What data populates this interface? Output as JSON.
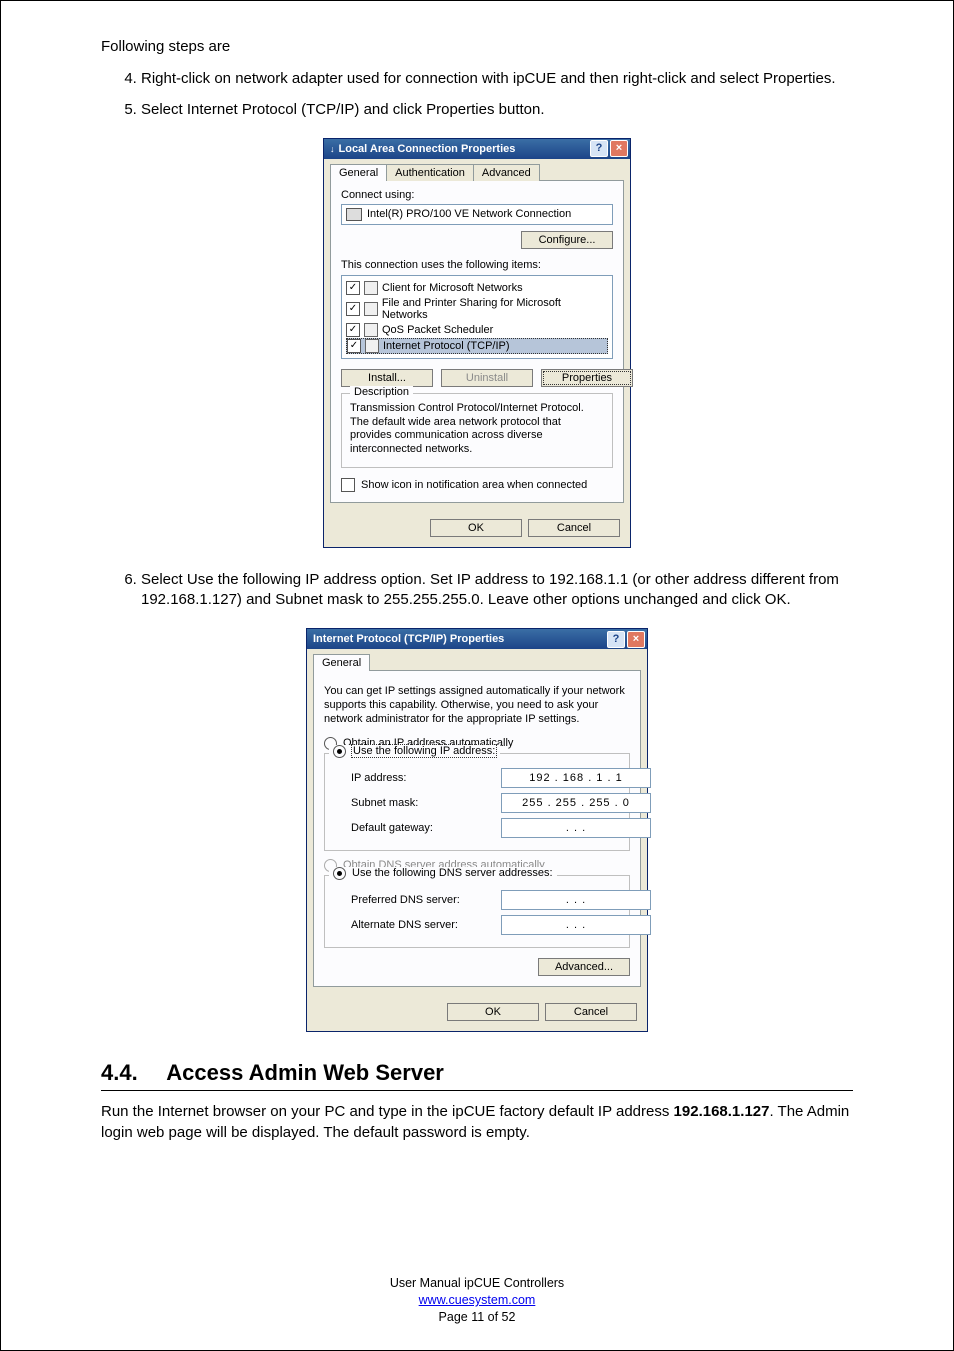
{
  "intro": "Following steps are",
  "steps": {
    "s4": "Right-click on network adapter used for connection with ipCUE and then right-click and select Properties.",
    "s5": "Select Internet Protocol (TCP/IP) and click Properties button.",
    "s6": "Select Use the following IP address option. Set IP address to 192.168.1.1 (or other address different from 192.168.1.127) and Subnet mask to 255.255.255.0. Leave other options unchanged and click OK."
  },
  "lan": {
    "title": "Local Area Connection Properties",
    "tabs": {
      "general": "General",
      "auth": "Authentication",
      "adv": "Advanced"
    },
    "connect_using": "Connect using:",
    "nic": "Intel(R) PRO/100 VE Network Connection",
    "configure": "Configure...",
    "uses_items": "This connection uses the following items:",
    "items": {
      "client": "Client for Microsoft Networks",
      "fps": "File and Printer Sharing for Microsoft Networks",
      "qos": "QoS Packet Scheduler",
      "tcpip": "Internet Protocol (TCP/IP)"
    },
    "install": "Install...",
    "uninstall": "Uninstall",
    "properties": "Properties",
    "desc_title": "Description",
    "desc": "Transmission Control Protocol/Internet Protocol. The default wide area network protocol that provides communication across diverse interconnected networks.",
    "show_icon": "Show icon in notification area when connected",
    "ok": "OK",
    "cancel": "Cancel"
  },
  "ip": {
    "title": "Internet Protocol (TCP/IP) Properties",
    "tab_general": "General",
    "desc": "You can get IP settings assigned automatically if your network supports this capability. Otherwise, you need to ask your network administrator for the appropriate IP settings.",
    "r_auto": "Obtain an IP address automatically",
    "r_use": "Use the following IP address:",
    "ip_label": "IP address:",
    "ip_val": "192 . 168 .   1  .   1",
    "sm_label": "Subnet mask:",
    "sm_val": "255 . 255 . 255 .  0",
    "gw_label": "Default gateway:",
    "gw_val": ".       .       .",
    "dns_auto": "Obtain DNS server address automatically",
    "dns_use": "Use the following DNS server addresses:",
    "pdns_label": "Preferred DNS server:",
    "pdns_val": ".       .       .",
    "adns_label": "Alternate DNS server:",
    "adns_val": ".       .       .",
    "advanced": "Advanced...",
    "ok": "OK",
    "cancel": "Cancel"
  },
  "section": {
    "num": "4.4.",
    "title": "Access Admin Web Server",
    "para_a": "Run the Internet browser on your PC and type in the ipCUE factory default IP address ",
    "ip": "192.168.1.127",
    "para_b": ". The Admin login web page will be displayed. The default password is empty."
  },
  "footer": {
    "line1": "User Manual ipCUE Controllers",
    "link": "www.cuesystem.com",
    "line3": "Page 11 of 52"
  }
}
